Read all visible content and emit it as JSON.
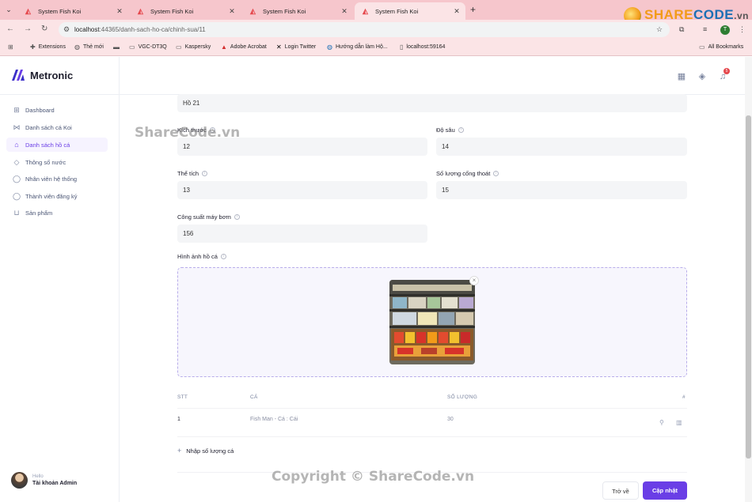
{
  "browser": {
    "tabs": [
      {
        "title": "System Fish Koi",
        "active": false
      },
      {
        "title": "System Fish Koi",
        "active": false
      },
      {
        "title": "System Fish Koi",
        "active": false
      },
      {
        "title": "System Fish Koi",
        "active": true
      }
    ],
    "url_host": "localhost",
    "url_path": ":44365/danh-sach-ho-ca/chinh-sua/11",
    "profile_initial": "T",
    "bookmarks": [
      "Extensions",
      "Thẻ mới",
      "VGC-DT3Q",
      "Kaspersky",
      "Adobe Acrobat",
      "Login Twitter",
      "Hướng dẫn làm Hộ...",
      "localhost:59164"
    ],
    "all_bookmarks": "All Bookmarks",
    "brand_overlay": {
      "share": "SHARE",
      "code": "CODE",
      "tld": ".vn"
    }
  },
  "app": {
    "brand": "Metronic",
    "notif_count": "5",
    "sidebar": [
      {
        "label": "Dashboard",
        "icon": "grid-icon",
        "active": false
      },
      {
        "label": "Danh sách cá Koi",
        "icon": "fish-icon",
        "active": false
      },
      {
        "label": "Danh sách hồ cá",
        "icon": "bank-icon",
        "active": true
      },
      {
        "label": "Thông số nước",
        "icon": "tag-icon",
        "active": false
      },
      {
        "label": "Nhân viên hệ thống",
        "icon": "user-icon",
        "active": false
      },
      {
        "label": "Thành viên đăng ký",
        "icon": "user-icon",
        "active": false
      },
      {
        "label": "Sản phẩm",
        "icon": "basket-icon",
        "active": false
      }
    ],
    "user": {
      "hello": "Hello",
      "name": "Tài khoản Admin"
    }
  },
  "form": {
    "name_value": "Hồ 21",
    "size_label": "Kích thước",
    "size_value": "12",
    "depth_label": "Độ sâu",
    "depth_value": "14",
    "volume_label": "Thể tích",
    "volume_value": "13",
    "drains_label": "Số lượng cống thoát",
    "drains_value": "15",
    "pump_label": "Công suất máy bơm",
    "pump_value": "156",
    "image_label": "Hình ảnh hồ cá"
  },
  "table": {
    "headers": [
      "STT",
      "CÁ",
      "SỐ LƯỢNG",
      "#"
    ],
    "rows": [
      {
        "stt": "1",
        "fish": "Fish Man - Cá : Cái",
        "qty": "30"
      }
    ],
    "add_label": "Nhập số lượng cá"
  },
  "buttons": {
    "back": "Trở về",
    "update": "Cập nhật"
  },
  "watermarks": {
    "top": "ShareCode.vn",
    "bottom": "Copyright © ShareCode.vn"
  },
  "colors": {
    "accent": "#6a3ee6",
    "tabbar": "#f6c6cc"
  }
}
